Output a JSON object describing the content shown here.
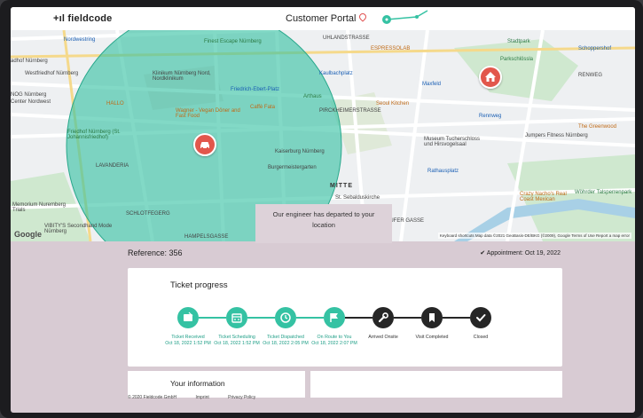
{
  "header": {
    "logo": "+ıl fieldcode",
    "portal_title": "Customer Portal"
  },
  "map": {
    "labels": {
      "nordwestring": "Nordwestring",
      "finest_escape": "Finest Escape Nürnberg",
      "uhlandstrasse": "UHLANDSTRASSE",
      "espressolab": "ESPRESSOLAB",
      "stadtpark": "Stadtpark",
      "schoppershof": "Schoppershof",
      "nuernberg_w": "adhof Nürnberg",
      "westfriedhof": "Westfriedhof Nürnberg",
      "klinikum": "Klinikum Nürnberg Nord, Nordklinikum",
      "kaulbachplatz": "Kaulbachplatz",
      "maxfeld": "Maxfeld",
      "parkschlössla": "Parkschlössla",
      "renweg": "RENWEG",
      "nog": "NOG Nürnberg",
      "dienstleistung": "Center Nordwest",
      "hallo": "HALLO",
      "friedrich_ebert": "Friedrich-Ebert-Platz",
      "arthaus": "Arthaus",
      "seoul_kitchen": "Seoul Kitchen",
      "wanger": "Wagner - Vegan Döner and Fast Food",
      "caffe_fata": "Caffè Fata",
      "pirckheimer": "PIRCKHEIMERSTRASSE",
      "rennweg": "Rennweg",
      "gruenes": "The Greenwood",
      "friedhof": "Friedhof Nürnberg (St. Johannisfriedhof)",
      "jumpers": "Jumpers Fitness Nürnberg",
      "museum": "Museum Tucherschloss und Hirsvogelsaal",
      "kaiserburg": "Kaiserburg Nürnberg",
      "lavanderia": "LAVANDERIA",
      "burgermeister": "Burgermeistergarten",
      "rathausplatz": "Rathausplatz",
      "mitte": "MITTE",
      "sebaldskirche": "St. Sebalduskirche",
      "crazy_nacho": "Crazy Nacho's Real Coast Mexican",
      "wohrder": "Wöhrder Talsperrenpark",
      "memorium": "Memorium Nuremberg Trials",
      "vibity": "VIBITY'S Secondhand Mode Nürnberg",
      "hampelsgasse": "HAMPELSGASSE",
      "laufer": "LAUFER GASSE",
      "schottlweg": "SCHLOTFEGERG",
      "google": "Google",
      "attribution": "Keyboard shortcuts   Map data ©2021 GeoBasis-DE/BKG (©2009), Google   Terms of Use   Report a map error"
    },
    "tooltip": "Our engineer has departed to your location"
  },
  "reference": {
    "label": "Reference: 356",
    "appointment": "✔ Appointment: Oct 19, 2022"
  },
  "ticket_progress": {
    "title": "Ticket progress",
    "steps": [
      {
        "label": "Ticket Received",
        "time": "Oct 18, 2022 1:52 PM",
        "status": "done",
        "icon": "ticket-icon"
      },
      {
        "label": "Ticket Scheduling",
        "time": "Oct 18, 2022 1:52 PM",
        "status": "done",
        "icon": "calendar-icon"
      },
      {
        "label": "Ticket Dispatched",
        "time": "Oct 18, 2022 2:05 PM",
        "status": "done",
        "icon": "clock-icon"
      },
      {
        "label": "On Route to You",
        "time": "Oct 18, 2022 2:07 PM",
        "status": "done",
        "icon": "flag-icon"
      },
      {
        "label": "Arrived Onsite",
        "time": "",
        "status": "todo",
        "icon": "wrench-icon"
      },
      {
        "label": "Visit Completed",
        "time": "",
        "status": "todo",
        "icon": "bookmark-icon"
      },
      {
        "label": "Closed",
        "time": "",
        "status": "todo",
        "icon": "check-icon"
      }
    ]
  },
  "info": {
    "title": "Your information"
  },
  "footer": {
    "copyright": "© 2020 Fieldcode GmbH",
    "imprint": "Imprint",
    "privacy": "Privacy Policy"
  },
  "colors": {
    "accent": "#35c2a3",
    "pending": "#262626",
    "marker": "#e2574c",
    "page_bg": "#d8cbd3"
  }
}
